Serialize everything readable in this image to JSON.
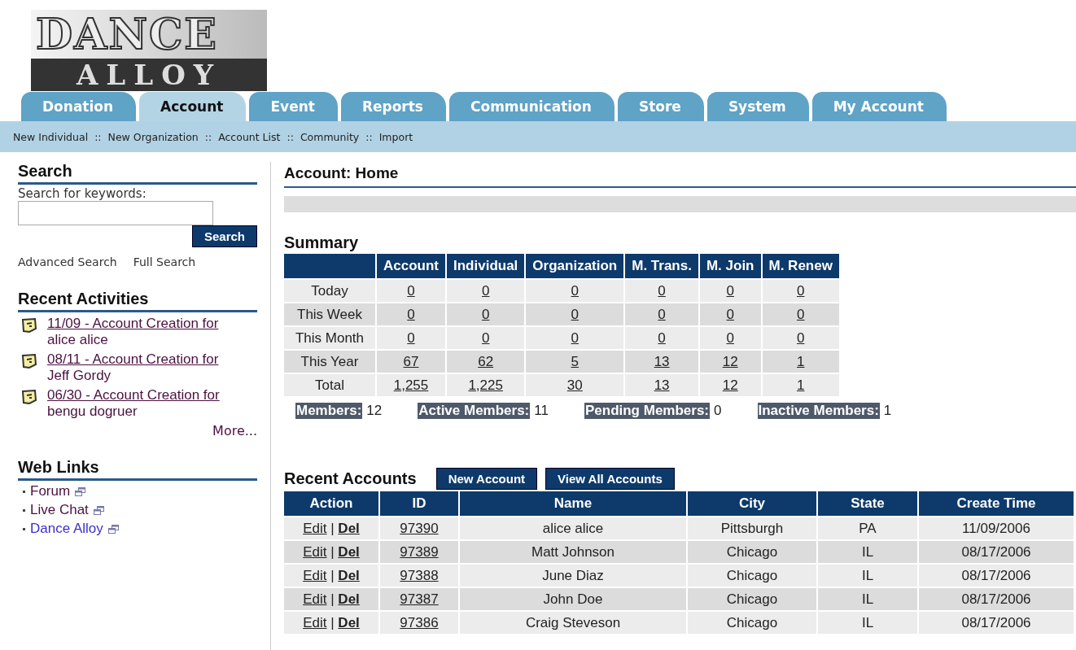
{
  "logo": {
    "line1": "DANCE",
    "line2": "ALLOY"
  },
  "tabs": [
    {
      "label": "Donation",
      "selected": false
    },
    {
      "label": "Account",
      "selected": true
    },
    {
      "label": "Event",
      "selected": false
    },
    {
      "label": "Reports",
      "selected": false
    },
    {
      "label": "Communication",
      "selected": false
    },
    {
      "label": "Store",
      "selected": false
    },
    {
      "label": "System",
      "selected": false
    },
    {
      "label": "My Account",
      "selected": false
    }
  ],
  "subnav": {
    "items": [
      "New Individual",
      "New Organization",
      "Account List",
      "Community",
      "Import"
    ],
    "separator": "::"
  },
  "sidebar": {
    "search": {
      "title": "Search",
      "label": "Search for keywords:",
      "button": "Search",
      "links": [
        "Advanced Search",
        "Full Search"
      ]
    },
    "activities": {
      "title": "Recent Activities",
      "items": [
        {
          "link": "11/09 - Account Creation for",
          "detail": "alice alice"
        },
        {
          "link": "08/11 - Account Creation for",
          "detail": "Jeff Gordy"
        },
        {
          "link": "06/30 - Account Creation for",
          "detail": "bengu dogruer"
        }
      ],
      "more": "More..."
    },
    "web_links": {
      "title": "Web Links",
      "items": [
        {
          "label": "Forum",
          "visited": false
        },
        {
          "label": "Live Chat",
          "visited": false
        },
        {
          "label": "Dance Alloy",
          "visited": true
        }
      ]
    }
  },
  "main": {
    "title": "Account: Home",
    "summary": {
      "title": "Summary",
      "columns": [
        "Account",
        "Individual",
        "Organization",
        "M. Trans.",
        "M. Join",
        "M. Renew"
      ],
      "rows": [
        {
          "label": "Today",
          "values": [
            "0",
            "0",
            "0",
            "0",
            "0",
            "0"
          ]
        },
        {
          "label": "This Week",
          "values": [
            "0",
            "0",
            "0",
            "0",
            "0",
            "0"
          ]
        },
        {
          "label": "This Month",
          "values": [
            "0",
            "0",
            "0",
            "0",
            "0",
            "0"
          ]
        },
        {
          "label": "This Year",
          "values": [
            "67",
            "62",
            "5",
            "13",
            "12",
            "1"
          ]
        },
        {
          "label": "Total",
          "values": [
            "1,255",
            "1,225",
            "30",
            "13",
            "12",
            "1"
          ]
        }
      ],
      "members": [
        {
          "label": "Members:",
          "value": "12"
        },
        {
          "label": "Active Members:",
          "value": "11"
        },
        {
          "label": "Pending Members:",
          "value": "0"
        },
        {
          "label": "Inactive Members:",
          "value": "1"
        }
      ]
    },
    "recent": {
      "title": "Recent Accounts",
      "buttons": [
        "New Account",
        "View All Accounts"
      ],
      "columns": [
        "Action",
        "ID",
        "Name",
        "City",
        "State",
        "Create Time"
      ],
      "rows": [
        {
          "edit": "Edit",
          "sep": "|",
          "del": "Del",
          "id": "97390",
          "name": "alice alice",
          "city": "Pittsburgh",
          "state": "PA",
          "created": "11/09/2006"
        },
        {
          "edit": "Edit",
          "sep": "|",
          "del": "Del",
          "id": "97389",
          "name": "Matt Johnson",
          "city": "Chicago",
          "state": "IL",
          "created": "08/17/2006"
        },
        {
          "edit": "Edit",
          "sep": "|",
          "del": "Del",
          "id": "97388",
          "name": "June Diaz",
          "city": "Chicago",
          "state": "IL",
          "created": "08/17/2006"
        },
        {
          "edit": "Edit",
          "sep": "|",
          "del": "Del",
          "id": "97387",
          "name": "John Doe",
          "city": "Chicago",
          "state": "IL",
          "created": "08/17/2006"
        },
        {
          "edit": "Edit",
          "sep": "|",
          "del": "Del",
          "id": "97386",
          "name": "Craig Steveson",
          "city": "Chicago",
          "state": "IL",
          "created": "08/17/2006"
        }
      ]
    }
  }
}
